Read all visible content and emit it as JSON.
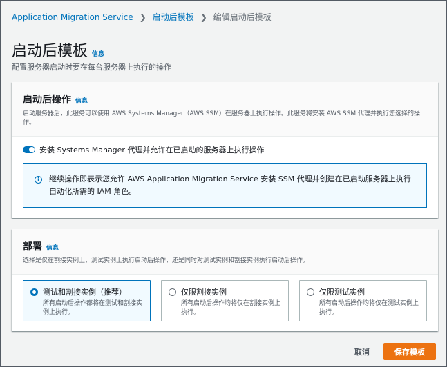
{
  "breadcrumb": {
    "items": [
      "Application Migration Service",
      "启动后模板"
    ],
    "current": "编辑启动后模板"
  },
  "header": {
    "title": "启动后模板",
    "info": "信息",
    "description": "配置服务器启动时要在每台服务器上执行的操作"
  },
  "post_launch": {
    "title": "启动后操作",
    "info": "信息",
    "description": "启动服务器后，此服务可以使用 AWS Systems Manager（AWS SSM）在服务器上执行操作。此服务将安装 AWS SSM 代理并执行您选择的操作。",
    "toggle_label": "安装 Systems Manager 代理并允许在已启动的服务器上执行操作",
    "toggle_on": true,
    "alert_text": "继续操作即表示您允许 AWS Application Migration Service 安装 SSM 代理并创建在已启动服务器上执行自动化所需的 IAM 角色。"
  },
  "deployment": {
    "title": "部署",
    "info": "信息",
    "description": "选择是仅在割接实例上、测试实例上执行启动后操作，还是同时对测试实例和割接实例执行启动后操作。",
    "options": [
      {
        "label": "测试和割接实例（推荐）",
        "desc": "所有启动后操作都将在测试和割接实例上执行。",
        "selected": true
      },
      {
        "label": "仅限割接实例",
        "desc": "所有启动后操作均将仅在割接实例上执行。",
        "selected": false
      },
      {
        "label": "仅限测试实例",
        "desc": "所有启动后操作均将仅在测试实例上执行。",
        "selected": false
      }
    ]
  },
  "footer": {
    "cancel": "取消",
    "save": "保存模板"
  },
  "colors": {
    "link": "#0073bb",
    "primary": "#ec7211"
  }
}
